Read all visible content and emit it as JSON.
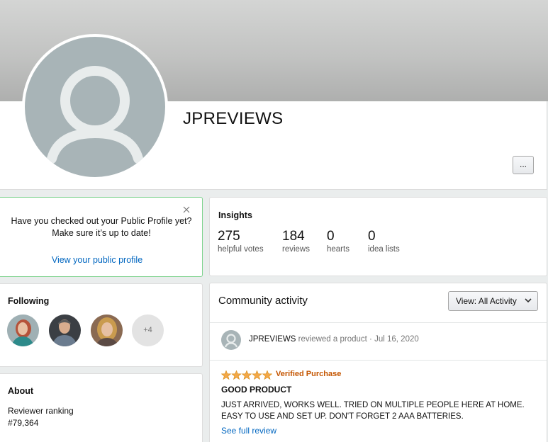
{
  "profile": {
    "name": "JPREVIEWS",
    "more_label": "..."
  },
  "notice": {
    "line1": "Have you checked out your Public Profile yet?",
    "line2": "Make sure it’s up to date!",
    "link": "View your public profile",
    "close_icon": "close-icon"
  },
  "insights": {
    "heading": "Insights",
    "stats": [
      {
        "value": "275",
        "label": "helpful votes"
      },
      {
        "value": "184",
        "label": "reviews"
      },
      {
        "value": "0",
        "label": "hearts"
      },
      {
        "value": "0",
        "label": "idea lists"
      }
    ]
  },
  "following": {
    "heading": "Following",
    "more_count": "+4"
  },
  "about": {
    "heading": "About",
    "ranking_label": "Reviewer ranking",
    "ranking_value": "#79,364"
  },
  "activity": {
    "title": "Community activity",
    "view_label": "View:",
    "view_value": "All Activity",
    "item": {
      "author": "JPREVIEWS",
      "action": "reviewed a product",
      "separator": "·",
      "date": "Jul 16, 2020",
      "rating": 5,
      "verified": "Verified Purchase",
      "title": "GOOD PRODUCT",
      "body": "JUST ARRIVED, WORKS WELL. TRIED ON MULTIPLE PEOPLE HERE AT HOME. EASY TO USE AND SET UP. DON'T FORGET 2 AAA BATTERIES.",
      "link": "See full review"
    }
  },
  "colors": {
    "link": "#0066c0",
    "verified": "#c45500",
    "star": "#f3a847",
    "notice_border": "#7fd38f",
    "avatar_bg": "#a8b4b7"
  }
}
